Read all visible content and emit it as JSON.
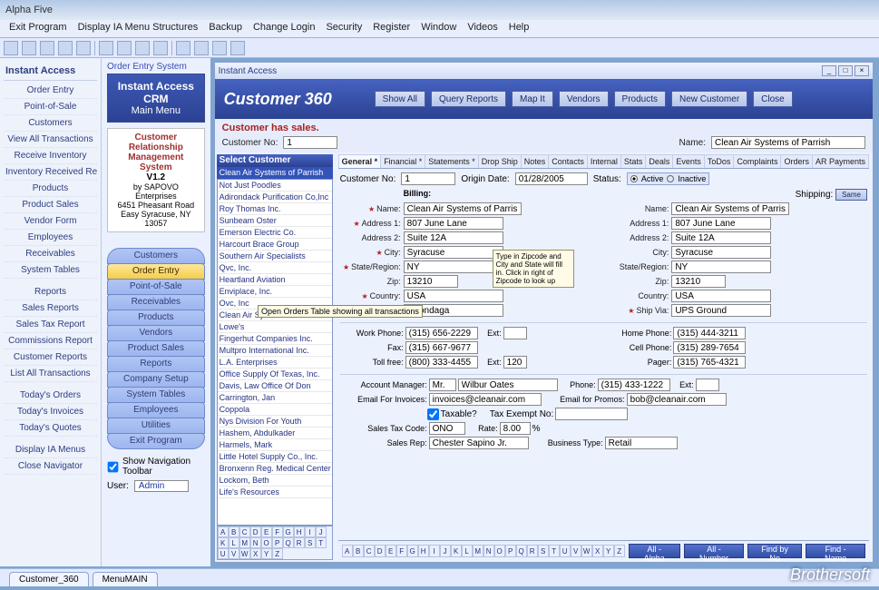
{
  "app": {
    "title": "Alpha Five"
  },
  "menubar": [
    "Exit Program",
    "Display IA Menu Structures",
    "Backup",
    "Change Login",
    "Security",
    "Register",
    "Window",
    "Videos",
    "Help"
  ],
  "left_nav": {
    "title": "Instant Access",
    "groups": [
      [
        "Order Entry",
        "Point-of-Sale",
        "Customers",
        "View All Transactions",
        "Receive Inventory",
        "Inventory Received Report",
        "Products",
        "Product Sales",
        "Vendor Form",
        "Employees",
        "Receivables",
        "System Tables"
      ],
      [
        "Reports",
        "Sales Reports",
        "Sales Tax Report",
        "Commissions Report",
        "Customer Reports",
        "List All Transactions"
      ],
      [
        "Today's Orders",
        "Today's Invoices",
        "Today's Quotes"
      ],
      [
        "Display IA Menus",
        "Close Navigator"
      ]
    ]
  },
  "center": {
    "box_title": "Order Entry System",
    "header_big": "Instant Access CRM",
    "header_sub": "Main Menu",
    "sub1": "Customer Relationship Management System",
    "sub2": "V1.2",
    "sub3": "by SAPOVO Enterprises",
    "sub4": "6451 Pheasant Road",
    "sub5": "Easy Syracuse, NY 13057",
    "buttons": [
      "Customers",
      "Order Entry",
      "Point-of-Sale",
      "Receivables",
      "Products",
      "Vendors",
      "Product Sales",
      "Reports",
      "Company Setup",
      "System Tables",
      "Employees",
      "Utilities",
      "Exit Program"
    ],
    "tooltip": "Open Orders Table showing all transactions",
    "show_nav": "Show Navigation Toolbar",
    "user_lbl": "User:",
    "user_val": "Admin"
  },
  "inner": {
    "title": "Instant Access",
    "header": "Customer 360",
    "hbtns": [
      "Show All",
      "Query Reports",
      "Map It",
      "Vendors",
      "Products",
      "New Customer",
      "Close"
    ],
    "has_sales": "Customer has sales.",
    "custno_lbl": "Customer No:",
    "custno": "1",
    "name_lbl": "Name:",
    "name": "Clean Air Systems of Parrish",
    "select_hdr": "Select Customer",
    "select_active": "Clean Air Systems of Parrish",
    "customers": [
      "Not Just Poodles",
      "Adirondack Purification Co,Inc",
      "Roy Thomas Inc.",
      "Sunbeam Oster",
      "Emerson Electric Co.",
      "Harcourt Brace Group",
      "Southern Air Specialists",
      "Qvc, Inc.",
      "Heartland Aviation",
      "Enviplace, Inc.",
      "Ovc, Inc",
      "Clean Air Systems - Alabama",
      "Lowe's",
      "Fingerhut Companies Inc.",
      "Multpro International Inc.",
      "L.A. Enterprises",
      "Office Supply Of Texas, Inc.",
      "Davis, Law Office Of Don",
      "Carrington, Jan",
      "Coppola",
      "Nys Division For Youth",
      "Hashem, Abdulkader",
      "Harmels, Mark",
      "Little Hotel Supply Co., Inc.",
      "Bronxenn Reg. Medical Center",
      "Lockom, Beth",
      "Life's Resources"
    ],
    "tabs": [
      "General *",
      "Financial *",
      "Statements *",
      "Drop Ship",
      "Notes",
      "Contacts",
      "Internal",
      "Stats",
      "Deals",
      "Events",
      "ToDos",
      "Complaints",
      "Orders",
      "AR Payments"
    ],
    "top_row": {
      "custno_lbl": "Customer No:",
      "custno": "1",
      "origin_lbl": "Origin Date:",
      "origin": "01/28/2005",
      "status_lbl": "Status:",
      "active": "Active",
      "inactive": "Inactive"
    },
    "billing_hdr": "Billing:",
    "shipping_hdr": "Shipping:",
    "same": "Same",
    "bill": {
      "name_l": "Name:",
      "name": "Clean Air Systems of Parrish",
      "a1_l": "Address 1:",
      "a1": "807 June Lane",
      "a2_l": "Address 2:",
      "a2": "Suite 12A",
      "city_l": "City:",
      "city": "Syracuse",
      "state_l": "State/Region:",
      "state": "NY",
      "zip_l": "Zip:",
      "zip": "13210",
      "country_l": "Country:",
      "country": "USA",
      "county_l": "County:",
      "county": "Onondaga"
    },
    "ship": {
      "name_l": "Name:",
      "name": "Clean Air Systems of Parrish",
      "a1_l": "Address 1:",
      "a1": "807 June Lane",
      "a2_l": "Address 2:",
      "a2": "Suite 12A",
      "city_l": "City:",
      "city": "Syracuse",
      "state_l": "State/Region:",
      "state": "NY",
      "zip_l": "Zip:",
      "zip": "13210",
      "country_l": "Country:",
      "country": "USA",
      "shipvia_l": "Ship Via:",
      "shipvia": "UPS Ground"
    },
    "zip_tip": "Type in Zipcode and City and State will fill in. Click in right of Zipcode to look up",
    "phones": {
      "work_l": "Work Phone:",
      "work": "(315) 656-2229",
      "ext_l": "Ext:",
      "fax_l": "Fax:",
      "fax": "(315) 667-9677",
      "toll_l": "Toll free:",
      "toll": "(800) 333-4455",
      "ext": "120",
      "home_l": "Home Phone:",
      "home": "(315) 444-3211",
      "cell_l": "Cell Phone:",
      "cell": "(315) 289-7654",
      "pager_l": "Pager:",
      "pager": "(315) 765-4321"
    },
    "acct": {
      "mgr_l": "Account Manager:",
      "mgr_prefix": "Mr.",
      "mgr": "Wilbur Oates",
      "phone_l": "Phone:",
      "phone": "(315) 433-1222",
      "ext_l": "Ext:",
      "einv_l": "Email For Invoices:",
      "einv": "invoices@cleanair.com",
      "eprom_l": "Email for Promos:",
      "eprom": "bob@cleanair.com",
      "tax_l": "Taxable?",
      "taxex_l": "Tax Exempt No:",
      "stx_l": "Sales Tax Code:",
      "stx": "ONO",
      "rate_l": "Rate:",
      "rate": "8.00",
      "pct": "%",
      "srep_l": "Sales Rep:",
      "srep": "Chester Sapino Jr.",
      "btype_l": "Business Type:",
      "btype": "Retail"
    },
    "footer_btns": [
      "All - Alpha",
      "All - Number",
      "Find by No",
      "Find - Name"
    ],
    "alphabet": [
      "A",
      "B",
      "C",
      "D",
      "E",
      "F",
      "G",
      "H",
      "I",
      "J",
      "K",
      "L",
      "M",
      "N",
      "O",
      "P",
      "Q",
      "R",
      "S",
      "T",
      "U",
      "V",
      "W",
      "X",
      "Y",
      "Z"
    ]
  },
  "bottom_tabs": [
    "Customer_360",
    "MenuMAIN"
  ],
  "watermark": "Brothersoft"
}
